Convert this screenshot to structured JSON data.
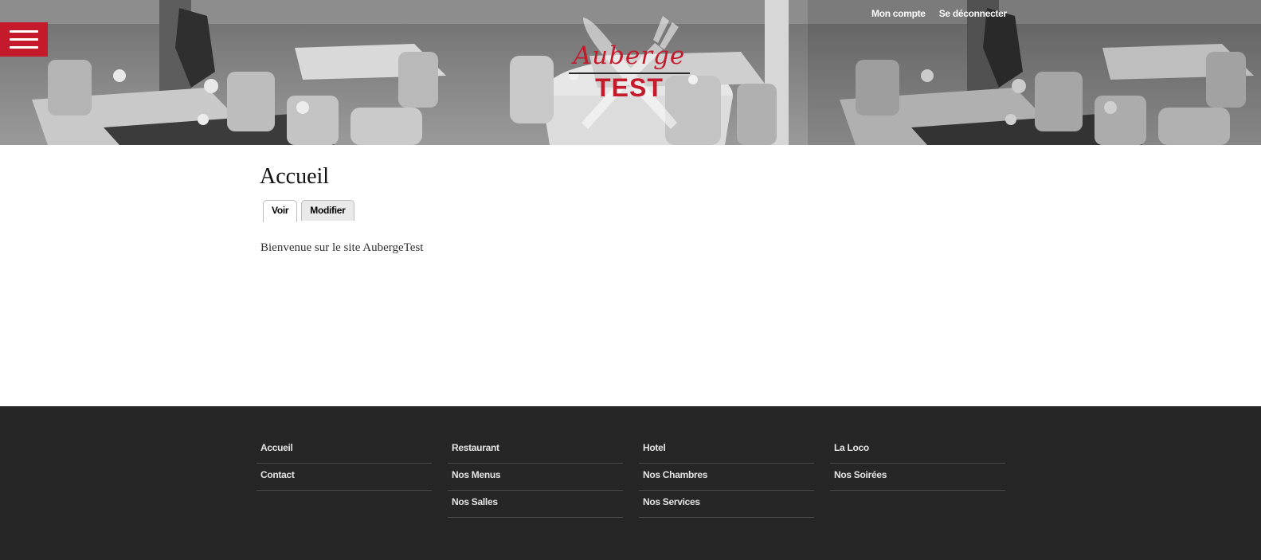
{
  "header": {
    "menu_icon": "hamburger-icon",
    "logo": {
      "script": "Auberge",
      "word": "TEST",
      "background": "crossed-fork-knife"
    },
    "account_link": "Mon compte",
    "logout_link": "Se déconnecter",
    "menu_color": "#c41a2c"
  },
  "main": {
    "title": "Accueil",
    "tabs": [
      {
        "label": "Voir",
        "active": true
      },
      {
        "label": "Modifier",
        "active": false
      }
    ],
    "content": "Bienvenue sur le site AubergeTest"
  },
  "footer": {
    "columns": [
      {
        "items": [
          "Accueil",
          "Contact"
        ]
      },
      {
        "items": [
          "Restaurant",
          "Nos Menus",
          "Nos Salles"
        ]
      },
      {
        "items": [
          "Hotel",
          "Nos Chambres",
          "Nos Services"
        ]
      },
      {
        "items": [
          "La Loco",
          "Nos Soirées"
        ]
      }
    ]
  },
  "colors": {
    "accent": "#c41a2c",
    "footer_bg": "#262626"
  }
}
